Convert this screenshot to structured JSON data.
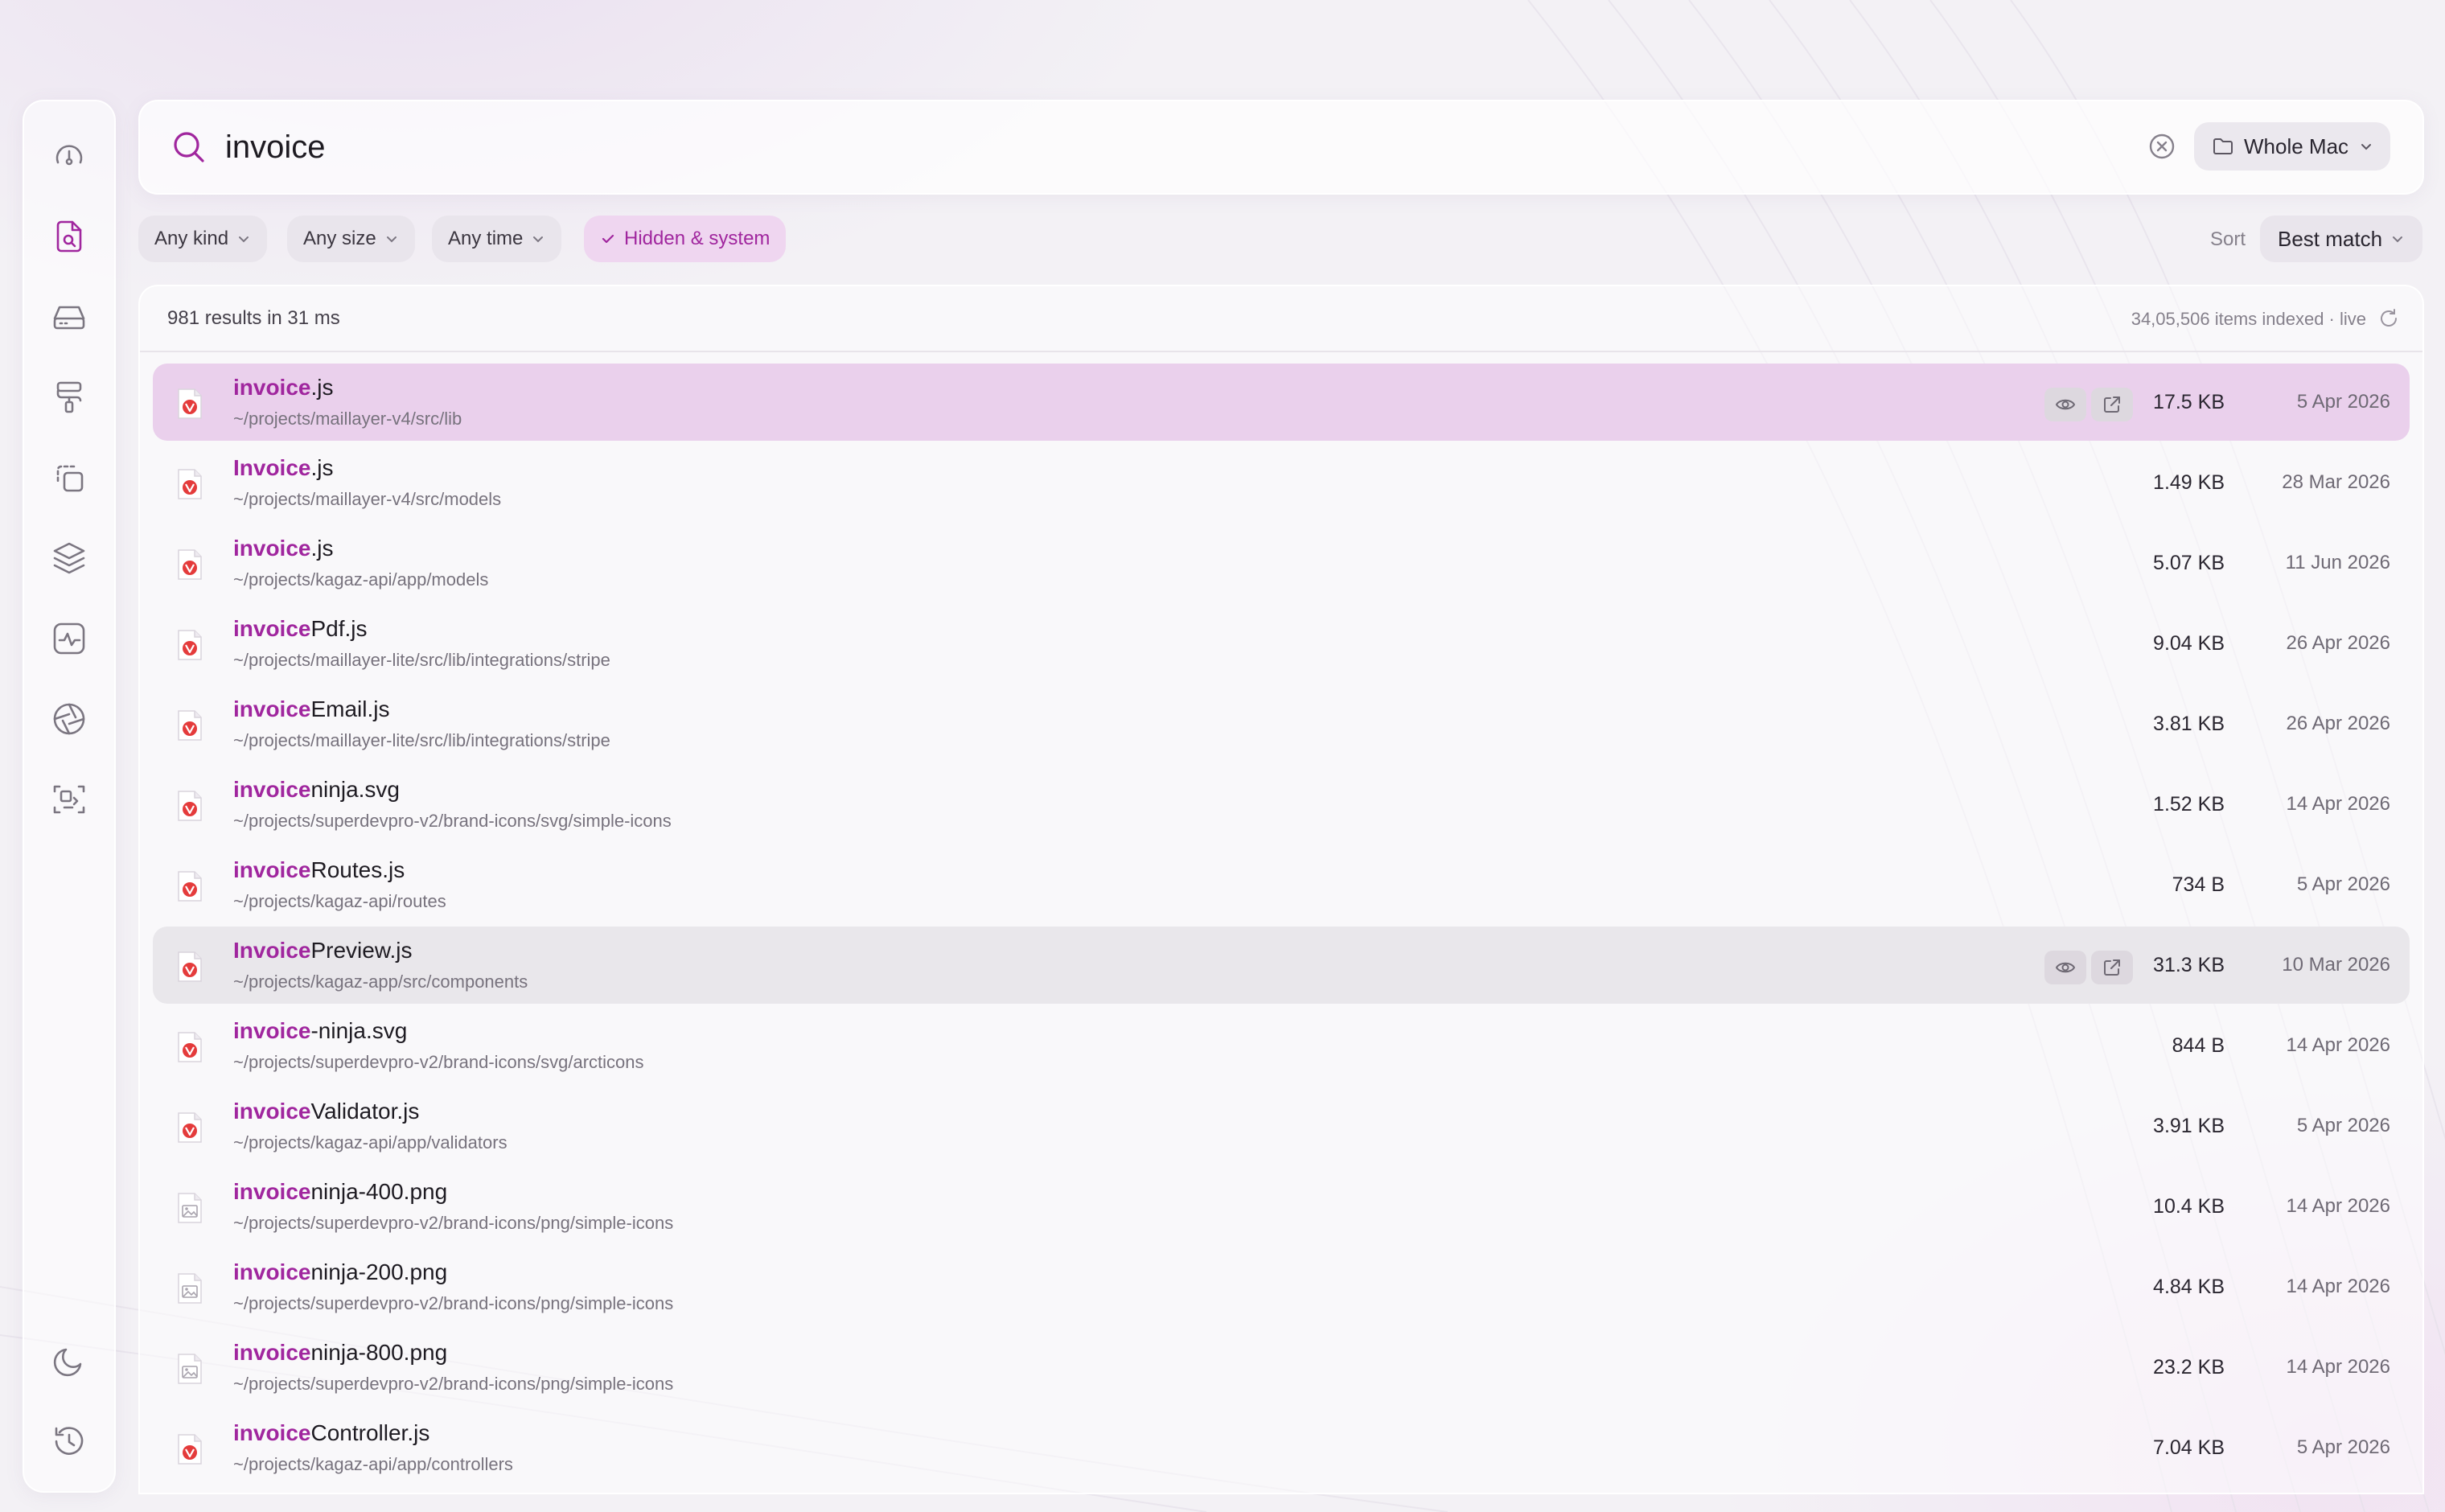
{
  "search": {
    "value": "invoice",
    "scope_label": "Whole Mac"
  },
  "filters": [
    {
      "label": "Any kind",
      "active": false
    },
    {
      "label": "Any size",
      "active": false
    },
    {
      "label": "Any time",
      "active": false
    },
    {
      "label": "Hidden & system",
      "active": true
    }
  ],
  "sort": {
    "label": "Sort",
    "value": "Best match"
  },
  "results": {
    "count_text": "981 results in 31 ms",
    "index_text": "34,05,506 items indexed · live",
    "rows": [
      {
        "match": "invoice",
        "rest": ".js",
        "path": "~/projects/maillayer-v4/src/lib",
        "size": "17.5 KB",
        "date": "5 Apr 2026",
        "kind": "code",
        "state": "selected"
      },
      {
        "match": "Invoice",
        "rest": ".js",
        "path": "~/projects/maillayer-v4/src/models",
        "size": "1.49 KB",
        "date": "28 Mar 2026",
        "kind": "code",
        "state": ""
      },
      {
        "match": "invoice",
        "rest": ".js",
        "path": "~/projects/kagaz-api/app/models",
        "size": "5.07 KB",
        "date": "11 Jun 2026",
        "kind": "code",
        "state": ""
      },
      {
        "match": "invoice",
        "rest": "Pdf.js",
        "path": "~/projects/maillayer-lite/src/lib/integrations/stripe",
        "size": "9.04 KB",
        "date": "26 Apr 2026",
        "kind": "code",
        "state": ""
      },
      {
        "match": "invoice",
        "rest": "Email.js",
        "path": "~/projects/maillayer-lite/src/lib/integrations/stripe",
        "size": "3.81 KB",
        "date": "26 Apr 2026",
        "kind": "code",
        "state": ""
      },
      {
        "match": "invoice",
        "rest": "ninja.svg",
        "path": "~/projects/superdevpro-v2/brand-icons/svg/simple-icons",
        "size": "1.52 KB",
        "date": "14 Apr 2026",
        "kind": "code",
        "state": ""
      },
      {
        "match": "invoice",
        "rest": "Routes.js",
        "path": "~/projects/kagaz-api/routes",
        "size": "734 B",
        "date": "5 Apr 2026",
        "kind": "code",
        "state": ""
      },
      {
        "match": "Invoice",
        "rest": "Preview.js",
        "path": "~/projects/kagaz-app/src/components",
        "size": "31.3 KB",
        "date": "10 Mar 2026",
        "kind": "code",
        "state": "hover"
      },
      {
        "match": "invoice",
        "rest": "-ninja.svg",
        "path": "~/projects/superdevpro-v2/brand-icons/svg/arcticons",
        "size": "844 B",
        "date": "14 Apr 2026",
        "kind": "code",
        "state": ""
      },
      {
        "match": "invoice",
        "rest": "Validator.js",
        "path": "~/projects/kagaz-api/app/validators",
        "size": "3.91 KB",
        "date": "5 Apr 2026",
        "kind": "code",
        "state": ""
      },
      {
        "match": "invoice",
        "rest": "ninja-400.png",
        "path": "~/projects/superdevpro-v2/brand-icons/png/simple-icons",
        "size": "10.4 KB",
        "date": "14 Apr 2026",
        "kind": "image",
        "state": ""
      },
      {
        "match": "invoice",
        "rest": "ninja-200.png",
        "path": "~/projects/superdevpro-v2/brand-icons/png/simple-icons",
        "size": "4.84 KB",
        "date": "14 Apr 2026",
        "kind": "image",
        "state": ""
      },
      {
        "match": "invoice",
        "rest": "ninja-800.png",
        "path": "~/projects/superdevpro-v2/brand-icons/png/simple-icons",
        "size": "23.2 KB",
        "date": "14 Apr 2026",
        "kind": "image",
        "state": ""
      },
      {
        "match": "invoice",
        "rest": "Controller.js",
        "path": "~/projects/kagaz-api/app/controllers",
        "size": "7.04 KB",
        "date": "5 Apr 2026",
        "kind": "code",
        "state": ""
      }
    ]
  },
  "sidebar": {
    "top_icons": [
      "gauge-icon",
      "file-search-icon",
      "drive-icon",
      "paint-roller-icon",
      "duplicate-icon",
      "layers-icon",
      "activity-icon",
      "aperture-icon",
      "scan-icon"
    ],
    "bottom_icons": [
      "moon-icon",
      "history-icon"
    ],
    "active": "file-search-icon"
  },
  "colors": {
    "accent": "#a0269e",
    "selected_row": "#ead0ec",
    "hover_row": "#e9e7eb"
  }
}
